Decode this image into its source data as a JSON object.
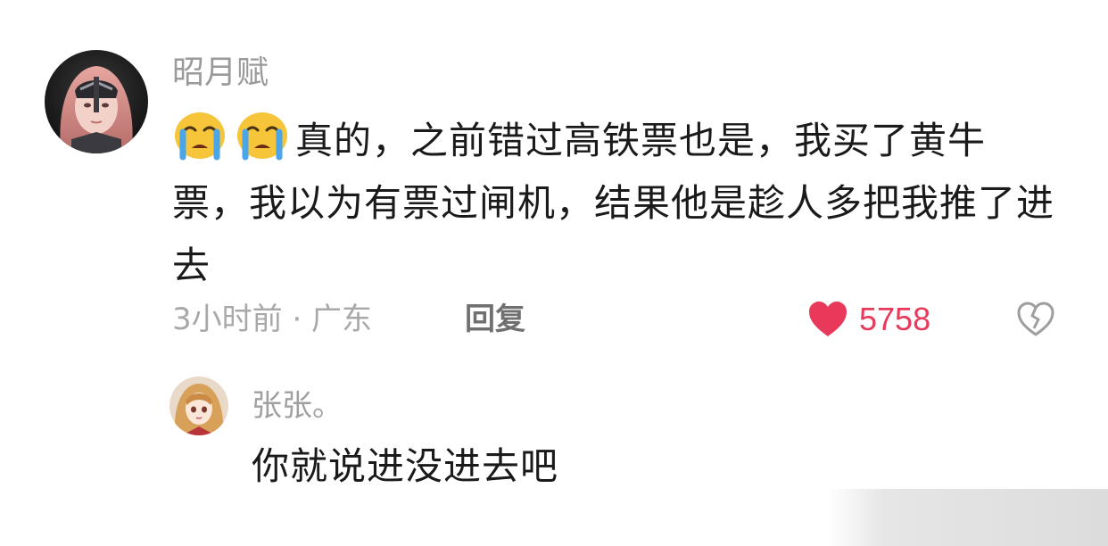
{
  "main_comment": {
    "author": "昭月赋",
    "emojis": [
      "crying-face-emoji",
      "crying-face-emoji"
    ],
    "text": "真的，之前错过高铁票也是，我买了黄牛票，我以为有票过闸机，结果他是趁人多把我推了进去",
    "time_location": "3小时前 · 广东",
    "reply_label": "回复",
    "like_count": "5758",
    "colors": {
      "like": "#e8395b",
      "meta_gray": "#a8a8a8",
      "author_gray": "#9a9a9a"
    }
  },
  "reply_comment": {
    "author": "张张。",
    "text": "你就说进没进去吧"
  }
}
